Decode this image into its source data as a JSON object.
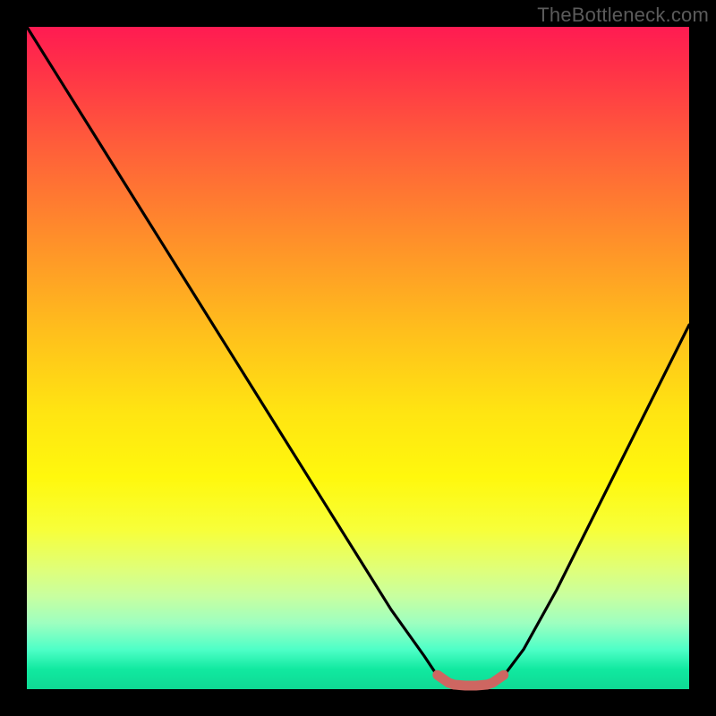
{
  "watermark": "TheBottleneck.com",
  "colors": {
    "frame": "#000000",
    "curve": "#000000",
    "marker": "#ce6661",
    "gradient_top": "#ff1b52",
    "gradient_bottom": "#0fd994"
  },
  "chart_data": {
    "type": "line",
    "title": "",
    "xlabel": "",
    "ylabel": "",
    "xlim": [
      0,
      100
    ],
    "ylim": [
      0,
      100
    ],
    "x": [
      0,
      5,
      10,
      15,
      20,
      25,
      30,
      35,
      40,
      45,
      50,
      55,
      60,
      62,
      64,
      66,
      68,
      70,
      72,
      75,
      80,
      85,
      90,
      95,
      100
    ],
    "values": [
      100,
      92,
      84,
      76,
      68,
      60,
      52,
      44,
      36,
      28,
      20,
      12,
      5,
      2,
      0.6,
      0.4,
      0.4,
      0.6,
      2,
      6,
      15,
      25,
      35,
      45,
      55
    ],
    "minimum_region_x": [
      62,
      72
    ],
    "annotations": []
  }
}
